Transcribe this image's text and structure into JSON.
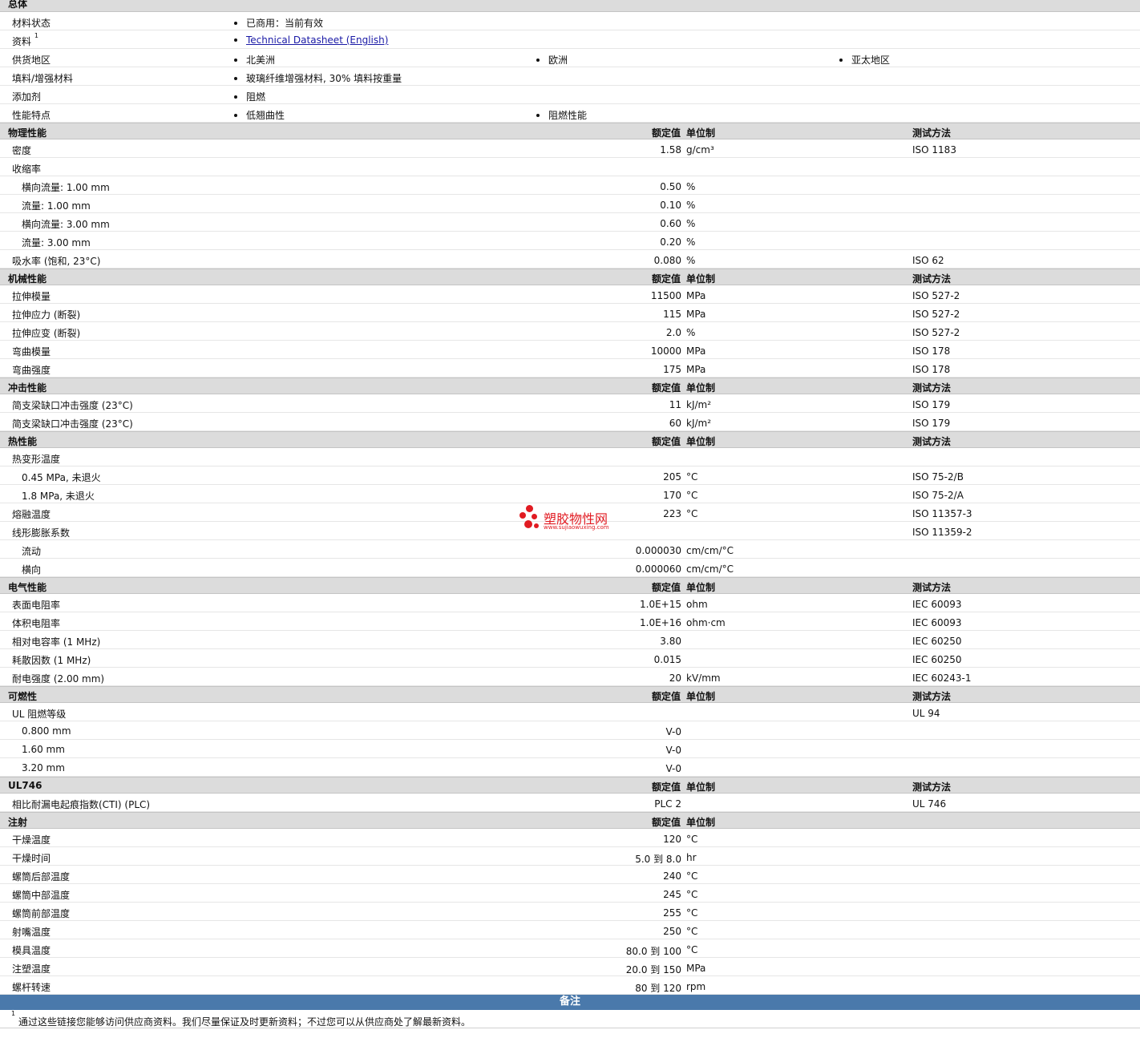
{
  "general": {
    "title": "总体",
    "rows": [
      {
        "label": "材料状态",
        "values": [
          "已商用：当前有效"
        ]
      },
      {
        "label": "资料",
        "sup": "1",
        "values": [
          "Technical Datasheet (English)"
        ],
        "link": true
      },
      {
        "label": "供货地区",
        "values": [
          "北美洲",
          "欧洲",
          "亚太地区"
        ]
      },
      {
        "label": "填料/增强材料",
        "values": [
          "玻璃纤维增强材料, 30% 填料按重量"
        ]
      },
      {
        "label": "添加剂",
        "values": [
          "阻燃"
        ]
      },
      {
        "label": "性能特点",
        "values": [
          "低翘曲性",
          "阻燃性能"
        ]
      }
    ]
  },
  "columns": {
    "nominal": "额定值",
    "unit": "单位制",
    "test": "测试方法"
  },
  "sections": [
    {
      "title": "物理性能",
      "show_cols": true,
      "rows": [
        {
          "label": "密度",
          "value": "1.58",
          "unit": "g/cm³",
          "test": "ISO 1183"
        },
        {
          "label": "收缩率",
          "value": "",
          "unit": "",
          "test": ""
        },
        {
          "label": "横向流量: 1.00 mm",
          "sub": true,
          "value": "0.50",
          "unit": "%",
          "test": ""
        },
        {
          "label": "流量: 1.00 mm",
          "sub": true,
          "value": "0.10",
          "unit": "%",
          "test": ""
        },
        {
          "label": "横向流量: 3.00 mm",
          "sub": true,
          "value": "0.60",
          "unit": "%",
          "test": ""
        },
        {
          "label": "流量: 3.00 mm",
          "sub": true,
          "value": "0.20",
          "unit": "%",
          "test": ""
        },
        {
          "label": "吸水率 (饱和, 23°C)",
          "value": "0.080",
          "unit": "%",
          "test": "ISO 62"
        }
      ]
    },
    {
      "title": "机械性能",
      "show_cols": true,
      "rows": [
        {
          "label": "拉伸模量",
          "value": "11500",
          "unit": "MPa",
          "test": "ISO 527-2"
        },
        {
          "label": "拉伸应力 (断裂)",
          "value": "115",
          "unit": "MPa",
          "test": "ISO 527-2"
        },
        {
          "label": "拉伸应变 (断裂)",
          "value": "2.0",
          "unit": "%",
          "test": "ISO 527-2"
        },
        {
          "label": "弯曲模量",
          "value": "10000",
          "unit": "MPa",
          "test": "ISO 178"
        },
        {
          "label": "弯曲强度",
          "value": "175",
          "unit": "MPa",
          "test": "ISO 178"
        }
      ]
    },
    {
      "title": "冲击性能",
      "show_cols": true,
      "rows": [
        {
          "label": "简支梁缺口冲击强度 (23°C)",
          "value": "11",
          "unit": "kJ/m²",
          "test": "ISO 179"
        },
        {
          "label": "简支梁缺口冲击强度 (23°C)",
          "value": "60",
          "unit": "kJ/m²",
          "test": "ISO 179"
        }
      ]
    },
    {
      "title": "热性能",
      "show_cols": true,
      "rows": [
        {
          "label": "热变形温度",
          "value": "",
          "unit": "",
          "test": ""
        },
        {
          "label": "0.45 MPa, 未退火",
          "sub": true,
          "value": "205",
          "unit": "°C",
          "test": "ISO 75-2/B"
        },
        {
          "label": "1.8 MPa, 未退火",
          "sub": true,
          "value": "170",
          "unit": "°C",
          "test": "ISO 75-2/A"
        },
        {
          "label": "熔融温度",
          "value": "223",
          "unit": "°C",
          "test": "ISO 11357-3"
        },
        {
          "label": "线形膨胀系数",
          "value": "",
          "unit": "",
          "test": "ISO 11359-2"
        },
        {
          "label": "流动",
          "sub": true,
          "value": "0.000030",
          "unit": "cm/cm/°C",
          "test": ""
        },
        {
          "label": "横向",
          "sub": true,
          "value": "0.000060",
          "unit": "cm/cm/°C",
          "test": ""
        }
      ]
    },
    {
      "title": "电气性能",
      "show_cols": true,
      "rows": [
        {
          "label": "表面电阻率",
          "value": "1.0E+15",
          "unit": "ohm",
          "test": "IEC 60093"
        },
        {
          "label": "体积电阻率",
          "value": "1.0E+16",
          "unit": "ohm·cm",
          "test": "IEC 60093"
        },
        {
          "label": "相对电容率 (1 MHz)",
          "value": "3.80",
          "unit": "",
          "test": "IEC 60250"
        },
        {
          "label": "耗散因数 (1 MHz)",
          "value": "0.015",
          "unit": "",
          "test": "IEC 60250"
        },
        {
          "label": "耐电强度 (2.00 mm)",
          "value": "20",
          "unit": "kV/mm",
          "test": "IEC 60243-1"
        }
      ]
    },
    {
      "title": "可燃性",
      "show_cols": true,
      "rows": [
        {
          "label": "UL 阻燃等级",
          "value": "",
          "unit": "",
          "test": "UL 94"
        },
        {
          "label": "0.800 mm",
          "sub": true,
          "value": "V-0",
          "unit": "",
          "test": ""
        },
        {
          "label": "1.60 mm",
          "sub": true,
          "value": "V-0",
          "unit": "",
          "test": ""
        },
        {
          "label": "3.20 mm",
          "sub": true,
          "value": "V-0",
          "unit": "",
          "test": ""
        }
      ]
    },
    {
      "title": "UL746",
      "show_cols": true,
      "rows": [
        {
          "label": "相比耐漏电起痕指数(CTI) (PLC)",
          "value": "PLC 2",
          "unit": "",
          "test": "UL 746"
        }
      ]
    },
    {
      "title": "注射",
      "show_cols": true,
      "show_test": false,
      "rows": [
        {
          "label": "干燥温度",
          "value": "120",
          "unit": "°C",
          "test": ""
        },
        {
          "label": "干燥时间",
          "value": "5.0 到  8.0",
          "unit": "hr",
          "test": ""
        },
        {
          "label": "螺筒后部温度",
          "value": "240",
          "unit": "°C",
          "test": ""
        },
        {
          "label": "螺筒中部温度",
          "value": "245",
          "unit": "°C",
          "test": ""
        },
        {
          "label": "螺筒前部温度",
          "value": "255",
          "unit": "°C",
          "test": ""
        },
        {
          "label": "射嘴温度",
          "value": "250",
          "unit": "°C",
          "test": ""
        },
        {
          "label": "模具温度",
          "value": "80.0 到  100",
          "unit": "°C",
          "test": ""
        },
        {
          "label": "注塑温度",
          "value": "20.0 到  150",
          "unit": "MPa",
          "test": ""
        },
        {
          "label": "螺杆转速",
          "value": "80 到  120",
          "unit": "rpm",
          "test": ""
        }
      ]
    }
  ],
  "notes": {
    "title": "备注",
    "items": [
      {
        "sup": "1",
        "text": "通过这些链接您能够访问供应商资料。我们尽量保证及时更新资料；不过您可以从供应商处了解最新资料。"
      }
    ]
  },
  "watermark": {
    "title": "塑胶物性网",
    "url": "www.sujiaowuxing.com",
    "color": "#e11b22"
  }
}
